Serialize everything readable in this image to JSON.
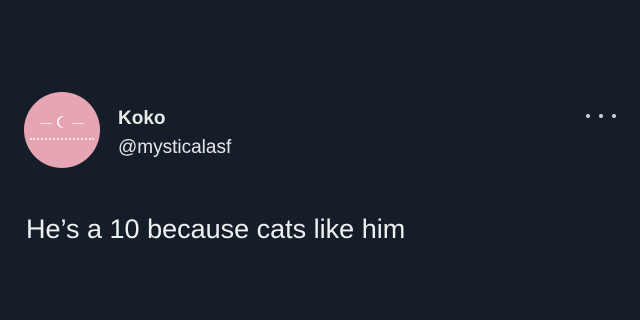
{
  "tweet": {
    "author": {
      "display_name": "Koko",
      "handle": "@mysticalasf"
    },
    "text": "He’s a 10 because cats like him",
    "more_icon": "more-horizontal-icon"
  },
  "colors": {
    "background": "#151d28",
    "avatar_bg": "#e6a5b3",
    "text_primary": "#e7e9ea"
  }
}
